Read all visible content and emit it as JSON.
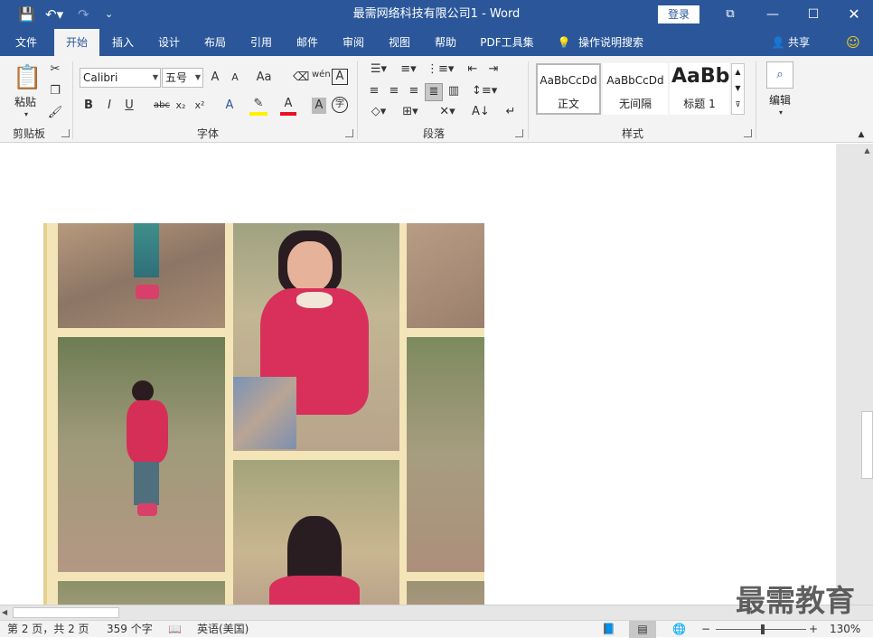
{
  "titlebar": {
    "title": "最需网络科技有限公司1 - Word",
    "login": "登录",
    "icons": [
      "save-icon",
      "undo-icon",
      "redo-icon",
      "customize-qat-icon",
      "ribbon-display-icon",
      "minimize-icon",
      "maximize-icon",
      "close-icon"
    ]
  },
  "tabs": [
    {
      "label": "文件"
    },
    {
      "label": "开始"
    },
    {
      "label": "插入"
    },
    {
      "label": "设计"
    },
    {
      "label": "布局"
    },
    {
      "label": "引用"
    },
    {
      "label": "邮件"
    },
    {
      "label": "审阅"
    },
    {
      "label": "视图"
    },
    {
      "label": "帮助"
    },
    {
      "label": "PDF工具集"
    },
    {
      "label": "操作说明搜索"
    }
  ],
  "active_tab": "开始",
  "share": "共享",
  "clipboard": {
    "paste": "粘贴",
    "label": "剪贴板"
  },
  "font": {
    "name": "Calibri",
    "size": "五号",
    "label": "字体",
    "change_case": "Aa",
    "bold": "B",
    "italic": "I",
    "underline": "U",
    "strike": "abc",
    "sub": "x₂",
    "sup": "x²",
    "phonetic": "wén",
    "enclose": "A",
    "grow": "A",
    "shrink": "A",
    "text_effect": "A",
    "font_color": "A",
    "shade": "A",
    "circle": "字"
  },
  "paragraph": {
    "label": "段落"
  },
  "styles": {
    "label": "样式",
    "items": [
      {
        "preview": "AaBbCcDd",
        "name": "正文"
      },
      {
        "preview": "AaBbCcDd",
        "name": "无间隔"
      },
      {
        "preview": "AaBb",
        "name": "标题 1"
      }
    ]
  },
  "editing": {
    "label": "编辑"
  },
  "status": {
    "page": "第 2 页，共 2 页",
    "words": "359 个字",
    "lang": "英语(美国)",
    "zoom": "130%",
    "minus": "−",
    "plus": "+"
  },
  "watermark": "最需教育",
  "colors": {
    "accent": "#2b579a",
    "font_red": "#e81123",
    "highlight_yellow": "#fff200"
  }
}
